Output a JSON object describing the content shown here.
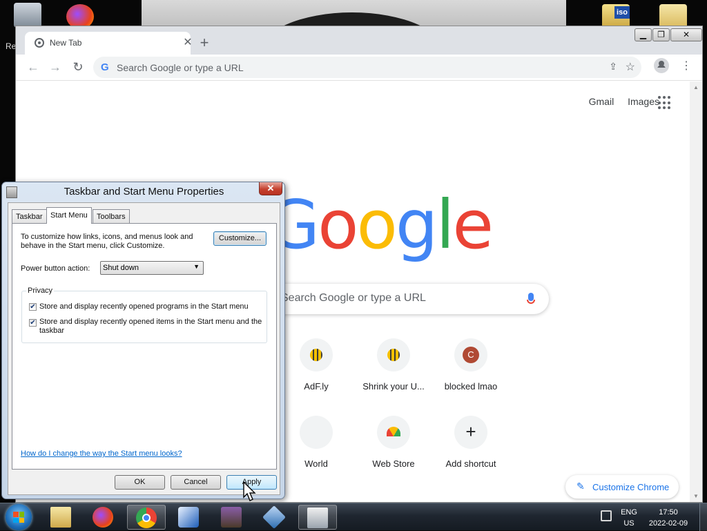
{
  "desktop": {
    "partial_label": "Re"
  },
  "chrome": {
    "tab_title": "New Tab",
    "tab_close": "✕",
    "new_tab": "+",
    "window_controls": [
      "▁",
      "❐",
      "✕"
    ],
    "omnibox_placeholder": "Search Google or type a URL",
    "header_links": [
      "Gmail",
      "Images"
    ],
    "logo_letters": [
      "G",
      "o",
      "o",
      "g",
      "l",
      "e"
    ],
    "logo_colors": [
      "#4285f4",
      "#ea4335",
      "#fbbc05",
      "#4285f4",
      "#34a853",
      "#ea4335"
    ],
    "search_placeholder": "Search Google or type a URL",
    "shortcuts_row1": [
      {
        "label": "AdF.ly",
        "icon": "bee-icon"
      },
      {
        "label": "Shrink your U...",
        "icon": "bee-icon"
      },
      {
        "label": "blocked lmao",
        "icon": "letter-avatar-icon",
        "avatar_letter": "C",
        "avatar_color": "#b04a34"
      }
    ],
    "shortcuts_row2": [
      {
        "label": "World",
        "icon": "generic-site-icon"
      },
      {
        "label": "Web Store",
        "icon": "web-store-icon"
      },
      {
        "label": "Add shortcut",
        "icon": "plus-icon"
      }
    ],
    "customize_label": "Customize Chrome"
  },
  "dialog": {
    "title": "Taskbar and Start Menu Properties",
    "close": "✕",
    "tabs": [
      "Taskbar",
      "Start Menu",
      "Toolbars"
    ],
    "active_tab": "Start Menu",
    "intro": "To customize how links, icons, and menus look and behave in the Start menu, click Customize.",
    "customize_button": "Customize...",
    "power_label": "Power button action:",
    "power_value": "Shut down",
    "privacy_label": "Privacy",
    "checkbox1": {
      "label": "Store and display recently opened programs in the Start menu",
      "checked": true
    },
    "checkbox2": {
      "label": "Store and display recently opened items in the Start menu and the taskbar",
      "checked": true
    },
    "help_link": "How do I change the way the Start menu looks?",
    "ok": "OK",
    "cancel": "Cancel",
    "apply": "Apply"
  },
  "taskbar": {
    "apps": [
      "file-explorer-icon",
      "firefox-icon",
      "chrome-icon",
      "app-icon",
      "winrar-icon",
      "virtualbox-icon",
      "control-panel-icon"
    ],
    "active_app": "chrome-icon",
    "lang_top": "ENG",
    "lang_bottom": "US",
    "time": "17:50",
    "date": "2022-02-09"
  }
}
